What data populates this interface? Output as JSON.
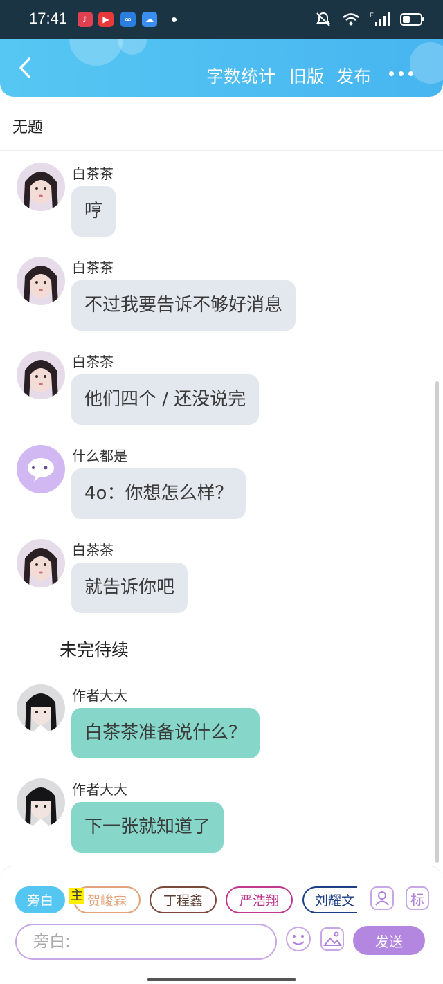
{
  "status_bar": {
    "time": "17:41",
    "network": "E"
  },
  "header": {
    "word_count_label": "字数统计",
    "old_version_label": "旧版",
    "publish_label": "发布"
  },
  "doc_title": "无题",
  "messages": [
    {
      "name": "白茶茶",
      "text": "哼",
      "avatar": "girl-photo"
    },
    {
      "name": "白茶茶",
      "text": "不过我要告诉不够好消息",
      "avatar": "girl-photo"
    },
    {
      "name": "白茶茶",
      "text": "他们四个 / 还没说完",
      "avatar": "girl-photo"
    },
    {
      "name": "什么都是",
      "text": "4o：你想怎么样？",
      "avatar": "chat-bubble"
    },
    {
      "name": "白茶茶",
      "text": "就告诉你吧",
      "avatar": "girl-photo"
    }
  ],
  "narration": "未完待续",
  "author_messages": [
    {
      "name": "作者大大",
      "text": "白茶茶准备说什么？",
      "avatar": "author-photo"
    },
    {
      "name": "作者大大",
      "text": "下一张就知道了",
      "avatar": "author-photo"
    }
  ],
  "composer": {
    "roles": [
      "旁白",
      "贺峻霖",
      "丁程鑫",
      "严浩翔",
      "刘耀文"
    ],
    "main_badge": "主",
    "tag_label": "标",
    "input_placeholder": "旁白:",
    "send_label": "发送"
  },
  "colors": {
    "header_blue": "#4fc0f2",
    "bubble_gray": "#e3e7ee",
    "bubble_green": "#86d7c9",
    "accent_purple": "#b386e0",
    "role_heijunlin": "#e2a27a",
    "role_dingchengxin": "#7a4a3a",
    "role_yanhaoxiang": "#c0388e",
    "role_liuyaowen": "#1d3f86"
  }
}
